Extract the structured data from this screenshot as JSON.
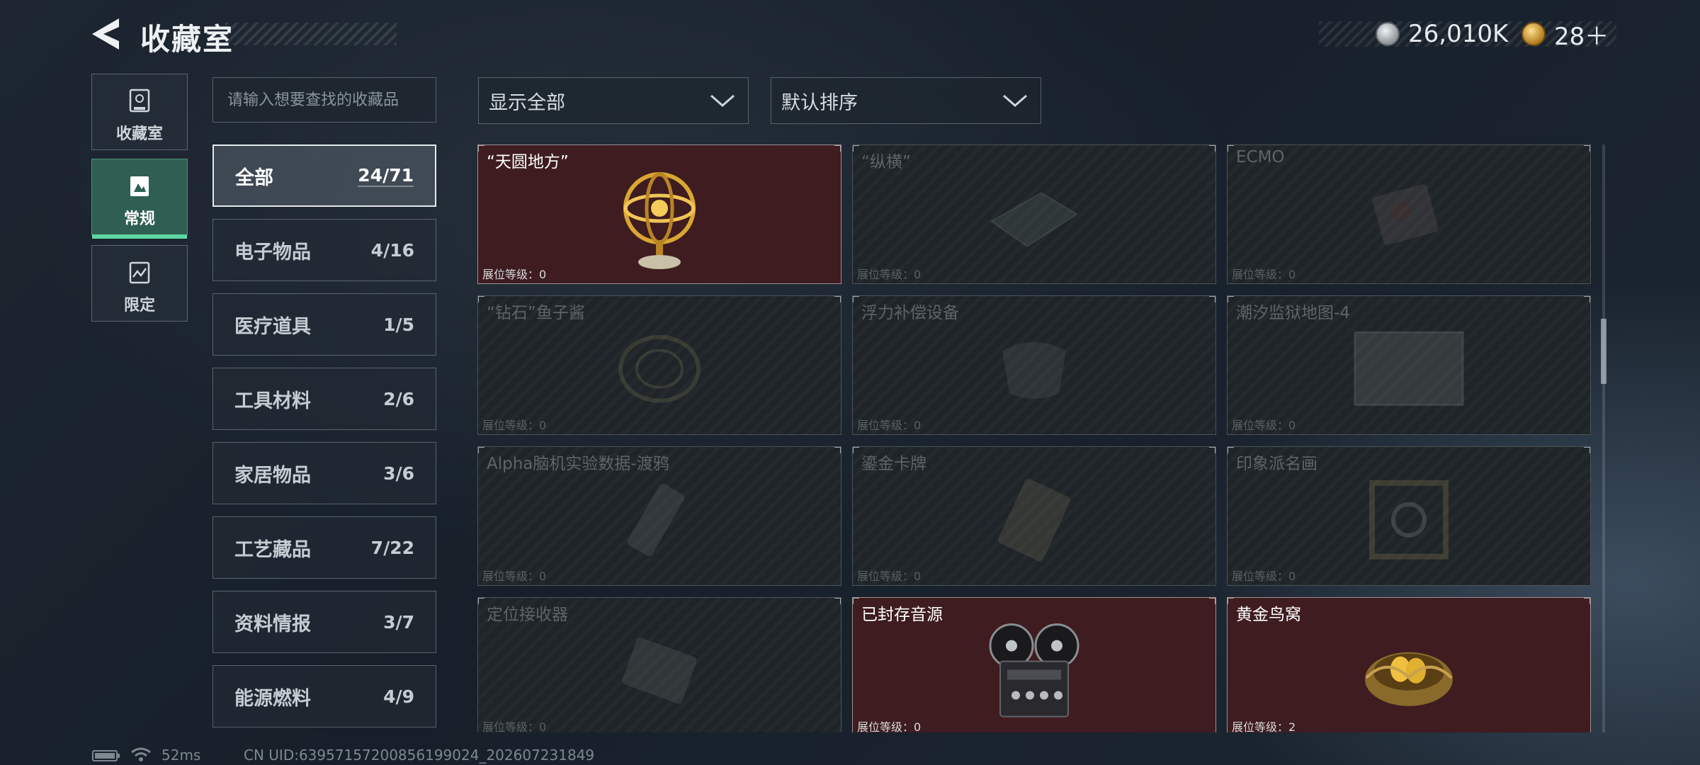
{
  "header": {
    "title": "收藏室",
    "currency_1": {
      "icon": "silver-coin-icon",
      "value": "26,010K"
    },
    "currency_2": {
      "icon": "gold-coin-icon",
      "value": "28＋"
    }
  },
  "rail": [
    {
      "label": "收藏室",
      "icon": "trophy-icon",
      "active": false
    },
    {
      "label": "常规",
      "icon": "display-icon",
      "active": true
    },
    {
      "label": "限定",
      "icon": "chart-icon",
      "active": false
    }
  ],
  "search": {
    "placeholder": "请输入想要查找的收藏品"
  },
  "categories": [
    {
      "name": "全部",
      "count": "24/71",
      "active": true
    },
    {
      "name": "电子物品",
      "count": "4/16"
    },
    {
      "name": "医疗道具",
      "count": "1/5"
    },
    {
      "name": "工具材料",
      "count": "2/6"
    },
    {
      "name": "家居物品",
      "count": "3/6"
    },
    {
      "name": "工艺藏品",
      "count": "7/22"
    },
    {
      "name": "资料情报",
      "count": "3/7"
    },
    {
      "name": "能源燃料",
      "count": "4/9"
    }
  ],
  "filters": {
    "show": "显示全部",
    "sort": "默认排序"
  },
  "items": [
    {
      "name": "“天圆地方”",
      "level": "展位等级：0",
      "owned": true,
      "icon": "armillary-sphere-icon"
    },
    {
      "name": "“纵横”",
      "level": "展位等级：0",
      "owned": false,
      "icon": "chessboard-icon"
    },
    {
      "name": "ECMO",
      "level": "展位等级：0",
      "owned": false,
      "icon": "ecmo-device-icon"
    },
    {
      "name": "“钻石”鱼子酱",
      "level": "展位等级：0",
      "owned": false,
      "icon": "caviar-tin-icon"
    },
    {
      "name": "浮力补偿设备",
      "level": "展位等级：0",
      "owned": false,
      "icon": "buoyancy-vest-icon"
    },
    {
      "name": "潮汐监狱地图-4",
      "level": "展位等级：0",
      "owned": false,
      "icon": "map-icon"
    },
    {
      "name": "Alpha脑机实验数据-渡鸦",
      "level": "展位等级：0",
      "owned": false,
      "icon": "data-drive-icon"
    },
    {
      "name": "鎏金卡牌",
      "level": "展位等级：0",
      "owned": false,
      "icon": "card-icon"
    },
    {
      "name": "印象派名画",
      "level": "展位等级：0",
      "owned": false,
      "icon": "painting-icon"
    },
    {
      "name": "定位接收器",
      "level": "展位等级：0",
      "owned": false,
      "icon": "receiver-icon"
    },
    {
      "name": "已封存音源",
      "level": "展位等级：0",
      "owned": true,
      "icon": "reel-tape-recorder-icon"
    },
    {
      "name": "黄金鸟窝",
      "level": "展位等级：2",
      "owned": true,
      "icon": "golden-nest-icon"
    }
  ],
  "status": {
    "ping": "52ms",
    "uid": "CN UID:6395715720085619902​4_202607231849"
  }
}
